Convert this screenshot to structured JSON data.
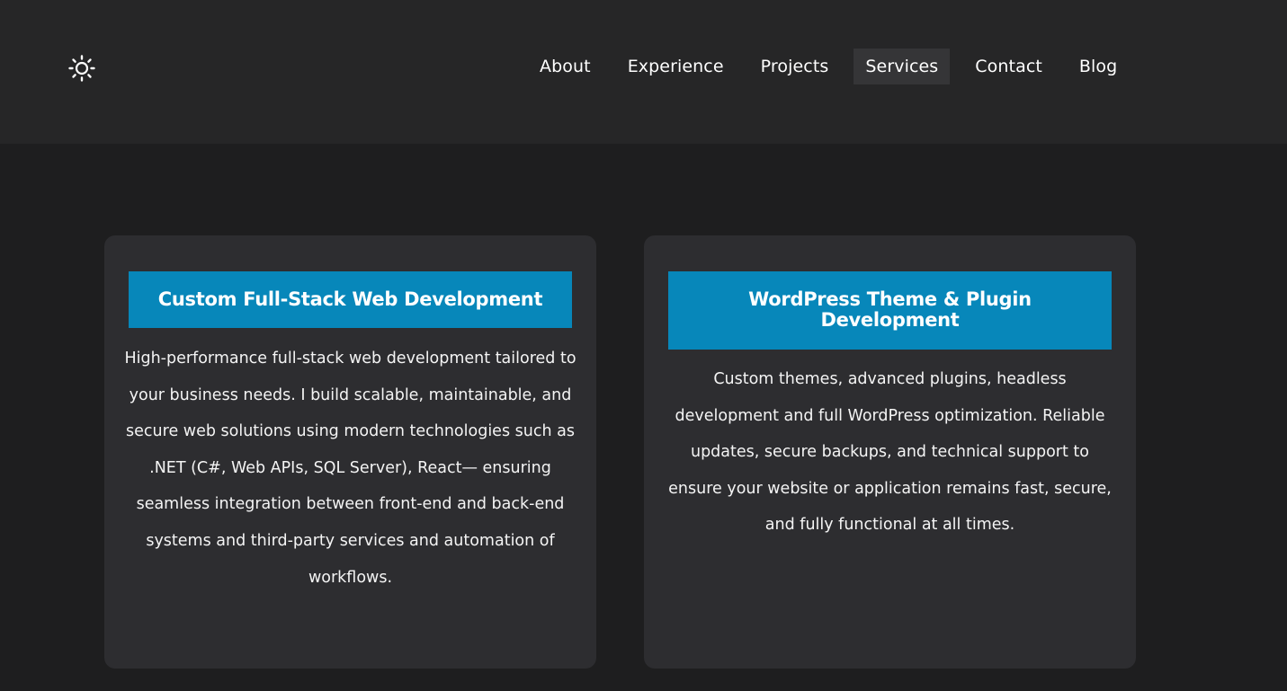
{
  "header": {
    "theme_toggle_icon": "sun-icon",
    "nav": [
      {
        "label": "About",
        "active": false
      },
      {
        "label": "Experience",
        "active": false
      },
      {
        "label": "Projects",
        "active": false
      },
      {
        "label": "Services",
        "active": true
      },
      {
        "label": "Contact",
        "active": false
      },
      {
        "label": "Blog",
        "active": false
      }
    ]
  },
  "services": [
    {
      "title": "Custom Full-Stack Web Development",
      "description": "High-performance full-stack web development tailored to your business needs. I build scalable, maintainable, and secure web solutions using modern technologies such as .NET (C#, Web APIs, SQL Server), React— ensuring seamless integration between front-end and back-end systems and third-party services and automation of workflows."
    },
    {
      "title": "WordPress Theme & Plugin Development",
      "description": "Custom themes, advanced plugins, headless development and full WordPress optimization. Reliable updates, secure backups, and technical support to ensure your website or application remains fast, secure, and fully functional at all times."
    }
  ],
  "colors": {
    "page_background": "#1e1e1f",
    "header_background": "#262627",
    "card_background": "#2d2d30",
    "accent": "#0787ba",
    "active_nav_background": "#353537"
  }
}
